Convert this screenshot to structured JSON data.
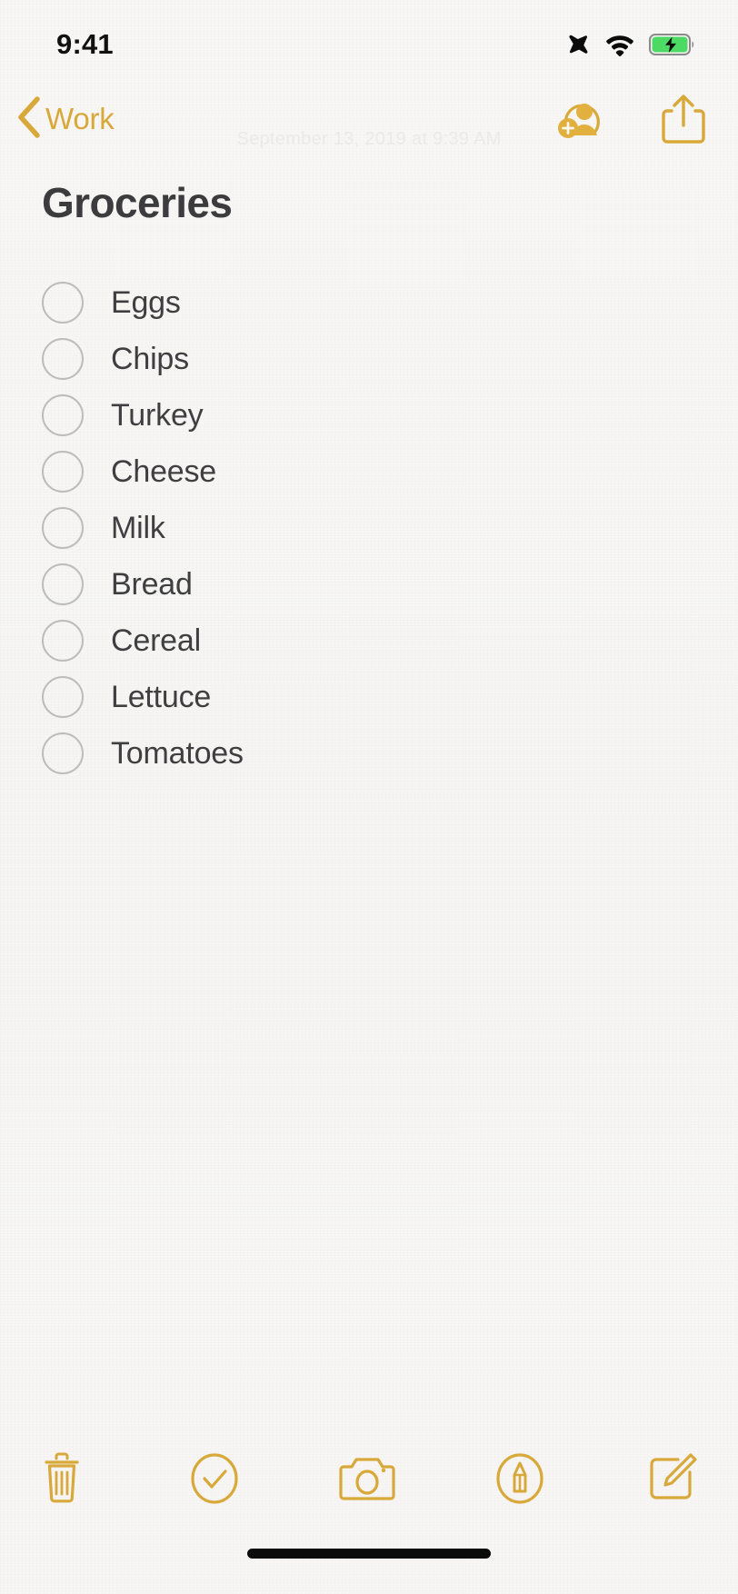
{
  "app": "Notes",
  "status_bar": {
    "time": "9:41",
    "icons": [
      {
        "name": "airplane-mode-icon",
        "label": "Airplane Mode"
      },
      {
        "name": "wifi-icon",
        "label": "Wi-Fi"
      },
      {
        "name": "battery-charging-icon",
        "label": "Battery Charging"
      }
    ],
    "battery_color": "#4CD964"
  },
  "nav_bar": {
    "back_label": "Work",
    "back_icon": "chevron-left-icon",
    "accent_color": "#D8A93A",
    "actions": [
      {
        "name": "add-person-icon",
        "label": "Add People"
      },
      {
        "name": "share-icon",
        "label": "Share"
      }
    ]
  },
  "note": {
    "ghost_date": "September 13, 2019 at 9:39 AM",
    "title": "Groceries",
    "title_color": "#3C3C3E",
    "checklist": [
      {
        "label": "Eggs",
        "checked": false
      },
      {
        "label": "Chips",
        "checked": false
      },
      {
        "label": "Turkey",
        "checked": false
      },
      {
        "label": "Cheese",
        "checked": false
      },
      {
        "label": "Milk",
        "checked": false
      },
      {
        "label": "Bread",
        "checked": false
      },
      {
        "label": "Cereal",
        "checked": false
      },
      {
        "label": "Lettuce",
        "checked": false
      },
      {
        "label": "Tomatoes",
        "checked": false
      }
    ]
  },
  "toolbar": {
    "accent_color": "#D8A93A",
    "items": [
      {
        "name": "delete-icon",
        "label": "Delete"
      },
      {
        "name": "checklist-icon",
        "label": "Checklist"
      },
      {
        "name": "camera-icon",
        "label": "Camera"
      },
      {
        "name": "markup-icon",
        "label": "Markup"
      },
      {
        "name": "compose-icon",
        "label": "New Note"
      }
    ]
  },
  "home_indicator": {
    "label": "Home Indicator"
  }
}
